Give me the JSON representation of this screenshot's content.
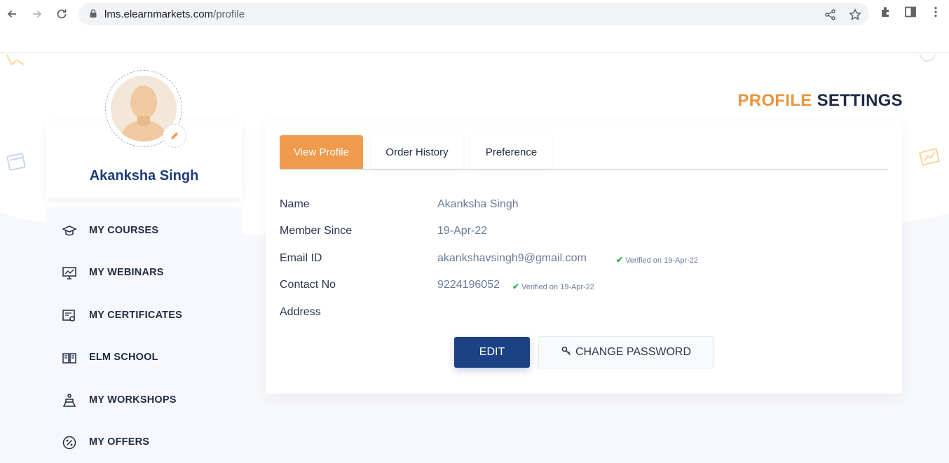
{
  "browser": {
    "url_host": "lms.elearnmarkets.com",
    "url_path": "/profile"
  },
  "page": {
    "title_part1": "PROFILE",
    "title_part2": " SETTINGS"
  },
  "user": {
    "name": "Akanksha Singh"
  },
  "sidebar": {
    "items": [
      {
        "label": "MY COURSES",
        "icon": "graduation-cap-icon"
      },
      {
        "label": "MY WEBINARS",
        "icon": "webinar-screen-icon"
      },
      {
        "label": "MY CERTIFICATES",
        "icon": "certificate-icon"
      },
      {
        "label": "ELM SCHOOL",
        "icon": "book-icon"
      },
      {
        "label": "MY WORKSHOPS",
        "icon": "workshop-icon"
      },
      {
        "label": "MY OFFERS",
        "icon": "percent-badge-icon"
      }
    ]
  },
  "tabs": [
    {
      "label": "View Profile",
      "active": true
    },
    {
      "label": "Order History",
      "active": false
    },
    {
      "label": "Preference",
      "active": false
    }
  ],
  "profile": {
    "name_label": "Name",
    "name_value": "Akanksha Singh",
    "member_label": "Member Since",
    "member_value": "19-Apr-22",
    "email_label": "Email ID",
    "email_value": "akankshavsingh9@gmail.com",
    "email_verified": "Verified on 19-Apr-22",
    "contact_label": "Contact No",
    "contact_value": "9224196052",
    "contact_verified": "Verified on 19-Apr-22",
    "address_label": "Address",
    "address_value": ""
  },
  "actions": {
    "edit_label": "EDIT",
    "change_password_label": "CHANGE PASSWORD"
  },
  "colors": {
    "accent": "#ef9a4c",
    "primary": "#1d4185",
    "verified": "#2bb24c"
  }
}
